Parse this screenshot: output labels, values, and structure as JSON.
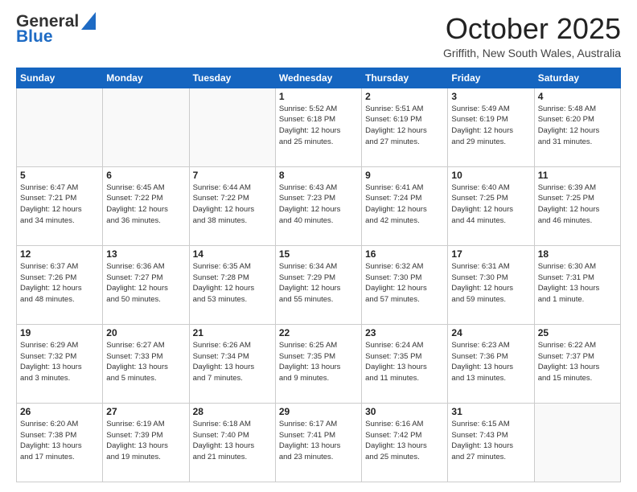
{
  "header": {
    "logo_general": "General",
    "logo_blue": "Blue",
    "month_title": "October 2025",
    "location": "Griffith, New South Wales, Australia"
  },
  "weekdays": [
    "Sunday",
    "Monday",
    "Tuesday",
    "Wednesday",
    "Thursday",
    "Friday",
    "Saturday"
  ],
  "weeks": [
    [
      {
        "day": "",
        "info": ""
      },
      {
        "day": "",
        "info": ""
      },
      {
        "day": "",
        "info": ""
      },
      {
        "day": "1",
        "info": "Sunrise: 5:52 AM\nSunset: 6:18 PM\nDaylight: 12 hours\nand 25 minutes."
      },
      {
        "day": "2",
        "info": "Sunrise: 5:51 AM\nSunset: 6:19 PM\nDaylight: 12 hours\nand 27 minutes."
      },
      {
        "day": "3",
        "info": "Sunrise: 5:49 AM\nSunset: 6:19 PM\nDaylight: 12 hours\nand 29 minutes."
      },
      {
        "day": "4",
        "info": "Sunrise: 5:48 AM\nSunset: 6:20 PM\nDaylight: 12 hours\nand 31 minutes."
      }
    ],
    [
      {
        "day": "5",
        "info": "Sunrise: 6:47 AM\nSunset: 7:21 PM\nDaylight: 12 hours\nand 34 minutes."
      },
      {
        "day": "6",
        "info": "Sunrise: 6:45 AM\nSunset: 7:22 PM\nDaylight: 12 hours\nand 36 minutes."
      },
      {
        "day": "7",
        "info": "Sunrise: 6:44 AM\nSunset: 7:22 PM\nDaylight: 12 hours\nand 38 minutes."
      },
      {
        "day": "8",
        "info": "Sunrise: 6:43 AM\nSunset: 7:23 PM\nDaylight: 12 hours\nand 40 minutes."
      },
      {
        "day": "9",
        "info": "Sunrise: 6:41 AM\nSunset: 7:24 PM\nDaylight: 12 hours\nand 42 minutes."
      },
      {
        "day": "10",
        "info": "Sunrise: 6:40 AM\nSunset: 7:25 PM\nDaylight: 12 hours\nand 44 minutes."
      },
      {
        "day": "11",
        "info": "Sunrise: 6:39 AM\nSunset: 7:25 PM\nDaylight: 12 hours\nand 46 minutes."
      }
    ],
    [
      {
        "day": "12",
        "info": "Sunrise: 6:37 AM\nSunset: 7:26 PM\nDaylight: 12 hours\nand 48 minutes."
      },
      {
        "day": "13",
        "info": "Sunrise: 6:36 AM\nSunset: 7:27 PM\nDaylight: 12 hours\nand 50 minutes."
      },
      {
        "day": "14",
        "info": "Sunrise: 6:35 AM\nSunset: 7:28 PM\nDaylight: 12 hours\nand 53 minutes."
      },
      {
        "day": "15",
        "info": "Sunrise: 6:34 AM\nSunset: 7:29 PM\nDaylight: 12 hours\nand 55 minutes."
      },
      {
        "day": "16",
        "info": "Sunrise: 6:32 AM\nSunset: 7:30 PM\nDaylight: 12 hours\nand 57 minutes."
      },
      {
        "day": "17",
        "info": "Sunrise: 6:31 AM\nSunset: 7:30 PM\nDaylight: 12 hours\nand 59 minutes."
      },
      {
        "day": "18",
        "info": "Sunrise: 6:30 AM\nSunset: 7:31 PM\nDaylight: 13 hours\nand 1 minute."
      }
    ],
    [
      {
        "day": "19",
        "info": "Sunrise: 6:29 AM\nSunset: 7:32 PM\nDaylight: 13 hours\nand 3 minutes."
      },
      {
        "day": "20",
        "info": "Sunrise: 6:27 AM\nSunset: 7:33 PM\nDaylight: 13 hours\nand 5 minutes."
      },
      {
        "day": "21",
        "info": "Sunrise: 6:26 AM\nSunset: 7:34 PM\nDaylight: 13 hours\nand 7 minutes."
      },
      {
        "day": "22",
        "info": "Sunrise: 6:25 AM\nSunset: 7:35 PM\nDaylight: 13 hours\nand 9 minutes."
      },
      {
        "day": "23",
        "info": "Sunrise: 6:24 AM\nSunset: 7:35 PM\nDaylight: 13 hours\nand 11 minutes."
      },
      {
        "day": "24",
        "info": "Sunrise: 6:23 AM\nSunset: 7:36 PM\nDaylight: 13 hours\nand 13 minutes."
      },
      {
        "day": "25",
        "info": "Sunrise: 6:22 AM\nSunset: 7:37 PM\nDaylight: 13 hours\nand 15 minutes."
      }
    ],
    [
      {
        "day": "26",
        "info": "Sunrise: 6:20 AM\nSunset: 7:38 PM\nDaylight: 13 hours\nand 17 minutes."
      },
      {
        "day": "27",
        "info": "Sunrise: 6:19 AM\nSunset: 7:39 PM\nDaylight: 13 hours\nand 19 minutes."
      },
      {
        "day": "28",
        "info": "Sunrise: 6:18 AM\nSunset: 7:40 PM\nDaylight: 13 hours\nand 21 minutes."
      },
      {
        "day": "29",
        "info": "Sunrise: 6:17 AM\nSunset: 7:41 PM\nDaylight: 13 hours\nand 23 minutes."
      },
      {
        "day": "30",
        "info": "Sunrise: 6:16 AM\nSunset: 7:42 PM\nDaylight: 13 hours\nand 25 minutes."
      },
      {
        "day": "31",
        "info": "Sunrise: 6:15 AM\nSunset: 7:43 PM\nDaylight: 13 hours\nand 27 minutes."
      },
      {
        "day": "",
        "info": ""
      }
    ]
  ]
}
